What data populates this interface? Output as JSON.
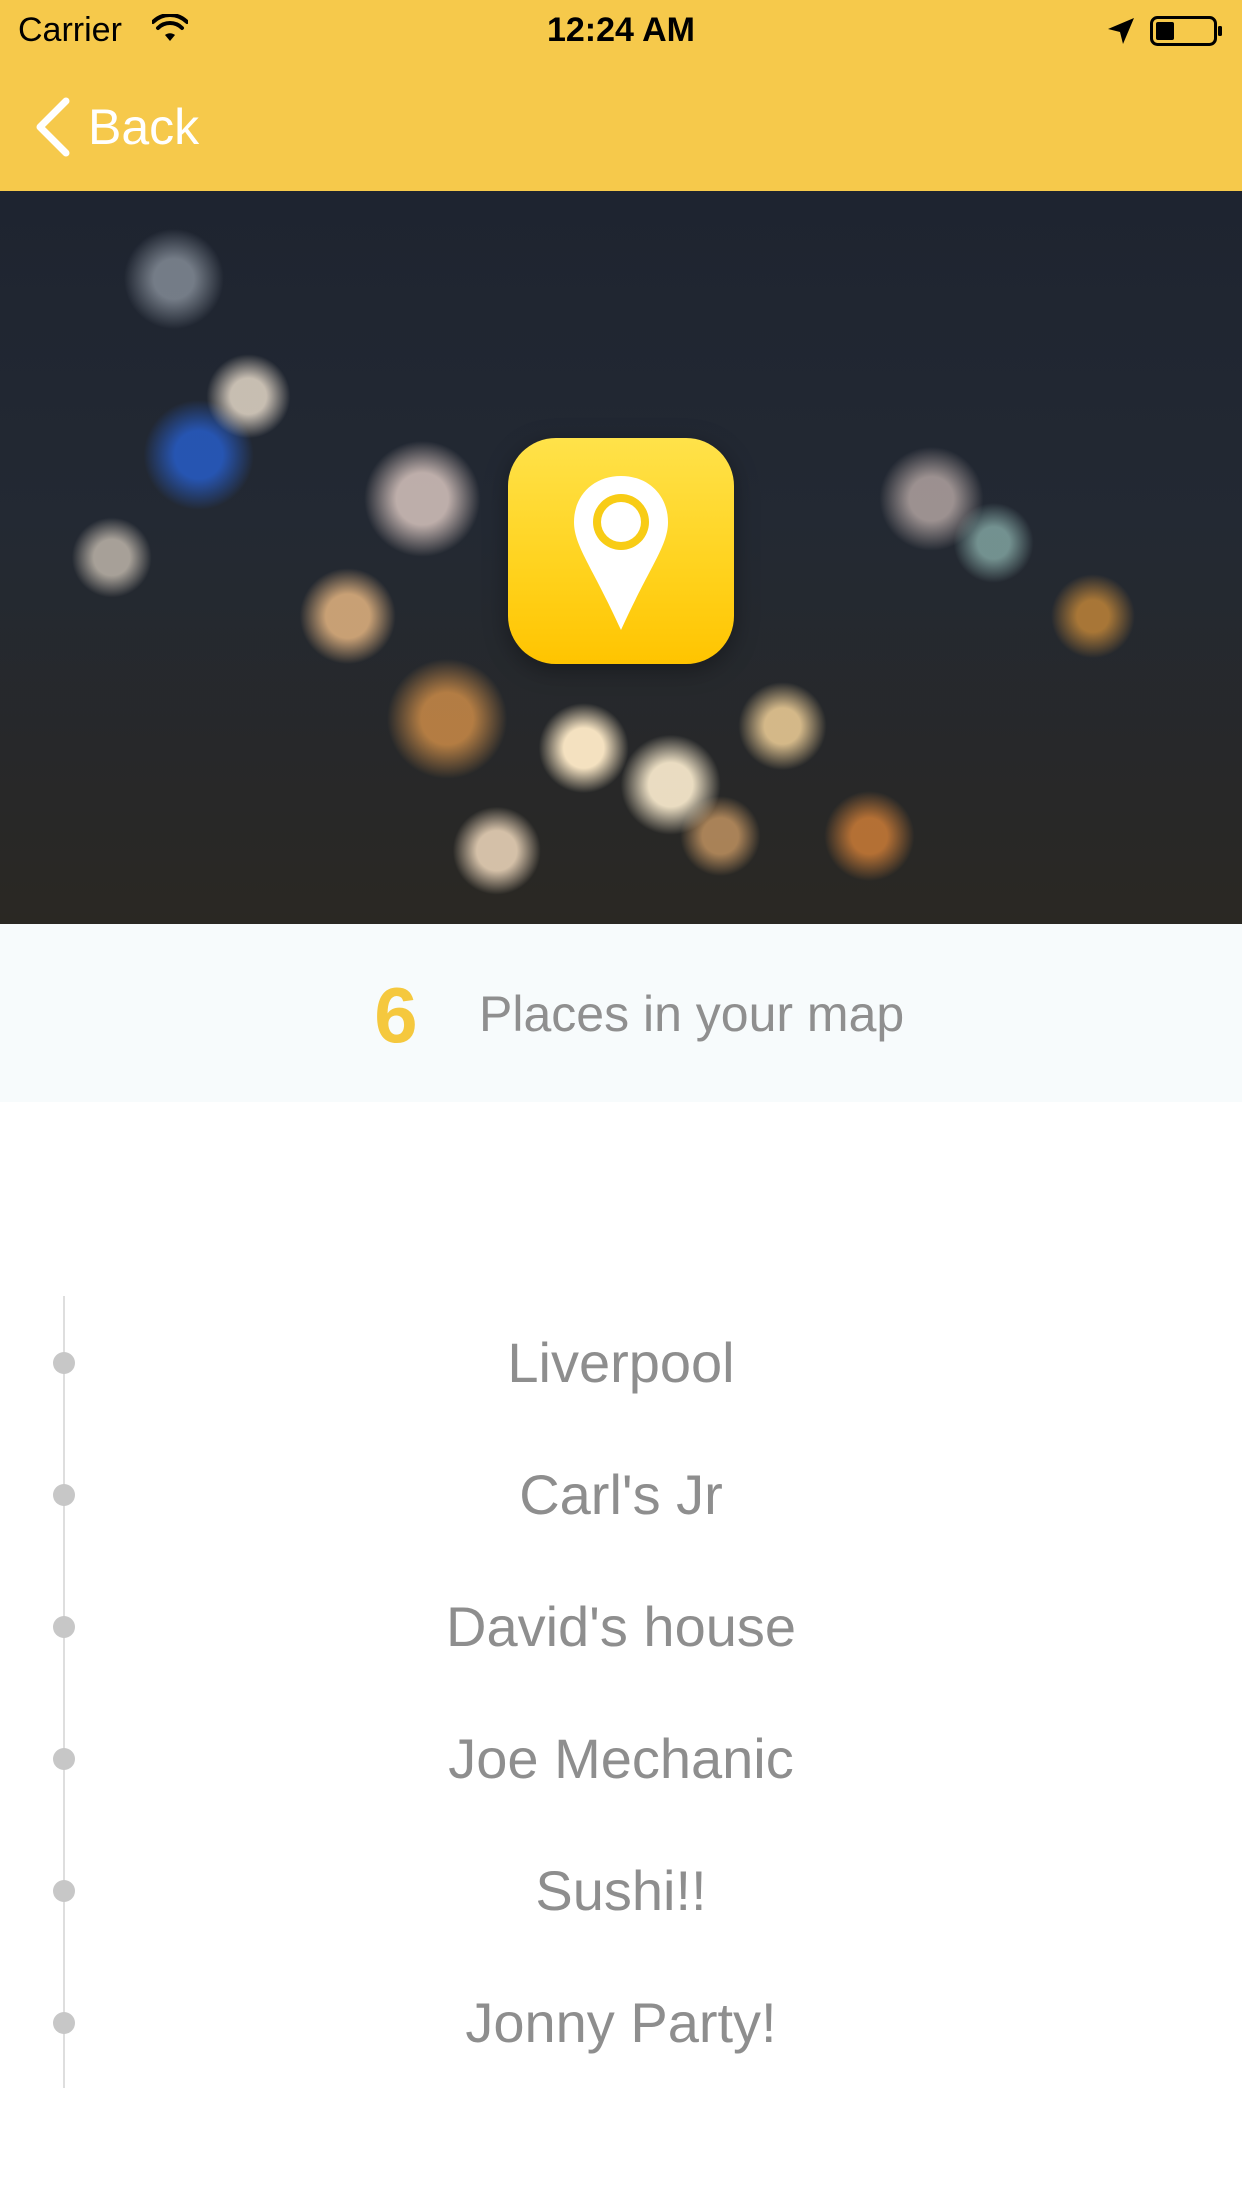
{
  "status_bar": {
    "carrier": "Carrier",
    "time": "12:24 AM"
  },
  "nav": {
    "back_label": "Back",
    "back_icon": "chevron-left-icon"
  },
  "hero": {
    "icon": "map-pin-icon"
  },
  "summary": {
    "count": "6",
    "label": "Places in your map"
  },
  "places": [
    {
      "name": "Liverpool"
    },
    {
      "name": "Carl's Jr"
    },
    {
      "name": "David's house"
    },
    {
      "name": "Joe Mechanic"
    },
    {
      "name": "Sushi!!"
    },
    {
      "name": "Jonny Party!"
    }
  ],
  "colors": {
    "accent": "#f6c94b",
    "count": "#f5c83e",
    "text_muted": "#8e8e8e",
    "banner_bg": "#f7fbfc"
  }
}
